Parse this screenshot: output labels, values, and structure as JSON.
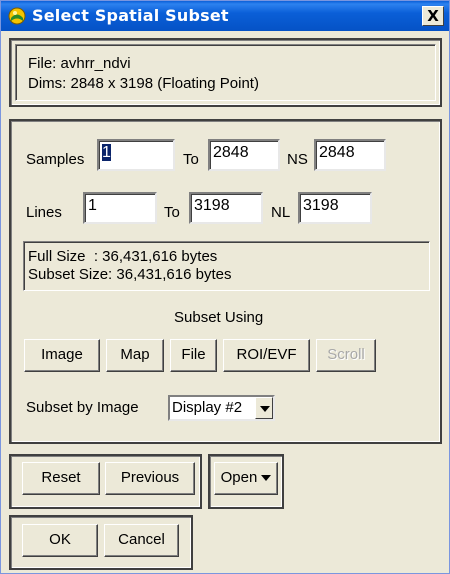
{
  "window": {
    "title": "Select Spatial Subset",
    "close_label": "X"
  },
  "info": {
    "file_line": "File: avhrr_ndvi",
    "dims_line": "Dims: 2848 x 3198 (Floating Point)"
  },
  "samples": {
    "label": "Samples",
    "from": "1",
    "to_label": "To",
    "to": "2848",
    "ns_label": "NS",
    "ns": "2848"
  },
  "lines": {
    "label": "Lines",
    "from": "1",
    "to_label": "To",
    "to": "3198",
    "nl_label": "NL",
    "nl": "3198"
  },
  "size": {
    "full": "Full Size  : 36,431,616 bytes",
    "subset": "Subset Size: 36,431,616 bytes"
  },
  "subset_using": {
    "label": "Subset Using",
    "buttons": {
      "image": "Image",
      "map": "Map",
      "file": "File",
      "roi": "ROI/EVF",
      "scroll": "Scroll"
    }
  },
  "subset_by": {
    "label": "Subset by Image",
    "value": "Display #2"
  },
  "actions": {
    "reset": "Reset",
    "previous": "Previous",
    "open": "Open",
    "ok": "OK",
    "cancel": "Cancel"
  },
  "colors": {
    "titlebar": "#0a5fd8",
    "face": "#ece9d8",
    "selection": "#0a246a"
  }
}
